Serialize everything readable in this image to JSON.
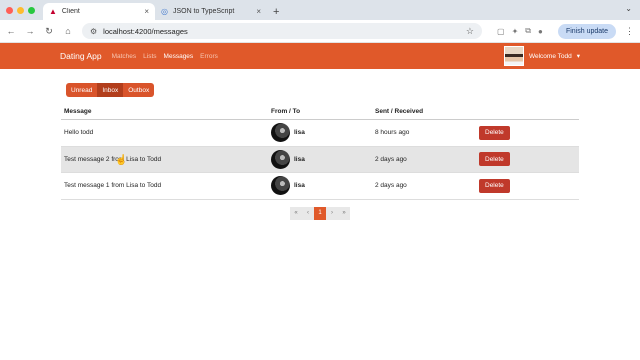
{
  "browser": {
    "tabs": [
      {
        "title": "Client",
        "active": true
      },
      {
        "title": "JSON to TypeScript",
        "active": false
      }
    ],
    "url": "localhost:4200/messages",
    "finish_update": "Finish update",
    "icons": {
      "back": "arrow-left-icon",
      "forward": "arrow-right-icon",
      "reload": "reload-icon",
      "home": "home-icon",
      "close": "×",
      "newtab": "+",
      "dropdown": "⌄",
      "star": "☆",
      "menu": "⋮"
    },
    "traffic_colors": [
      "#ff5f57",
      "#febc2e",
      "#28c840"
    ]
  },
  "navbar": {
    "brand": "Dating App",
    "links": [
      "Matches",
      "Lists",
      "Messages",
      "Errors"
    ],
    "active_link": "Messages",
    "welcome": "Welcome Todd",
    "caret": "▾",
    "accent": "#e0592a"
  },
  "filters": {
    "buttons": [
      "Unread",
      "Inbox",
      "Outbox"
    ],
    "active": "Inbox"
  },
  "table": {
    "headers": [
      "Message",
      "From / To",
      "Sent / Received",
      ""
    ],
    "rows": [
      {
        "message": "Hello todd",
        "user": "lisa",
        "time": "8 hours ago",
        "action": "Delete"
      },
      {
        "message": "Test message 2 from Lisa to Todd",
        "user": "lisa",
        "time": "2 days ago",
        "action": "Delete"
      },
      {
        "message": "Test message 1 from Lisa to Todd",
        "user": "lisa",
        "time": "2 days ago",
        "action": "Delete"
      }
    ]
  },
  "pagination": {
    "first": "«",
    "prev": "‹",
    "current": "1",
    "next": "›",
    "last": "»"
  }
}
